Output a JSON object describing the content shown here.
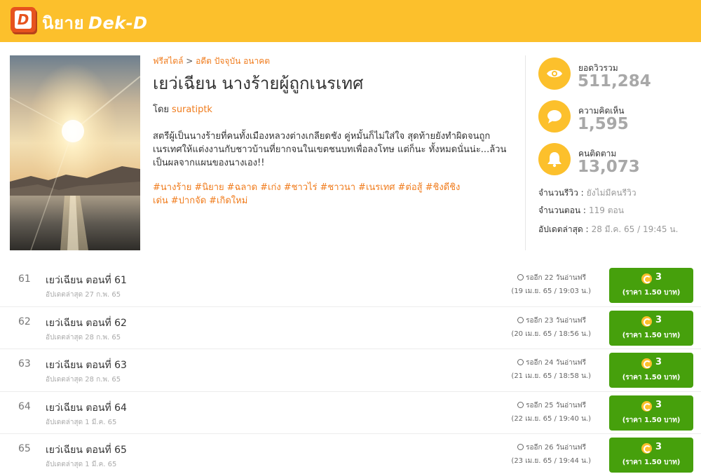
{
  "header": {
    "logo_letter": "D",
    "brand_thai": "นิยาย",
    "brand_dekd": "Dek-D"
  },
  "novel": {
    "breadcrumb": {
      "category": "ฟรีสไตล์",
      "separator": ">",
      "subcategory": "อดีต ปัจจุบัน อนาคต"
    },
    "title": "เยว่เฉียน นางร้ายผู้ถูกเนรเทศ",
    "by_label": "โดย",
    "author": "suratiptk",
    "synopsis": "สตรีผู้เป็นนางร้ายที่คนทั้งเมืองหลวงต่างเกลียดชัง คู่หมั้นก็ไม่ใส่ใจ สุดท้ายยังทำผิดจนถูกเนรเทศให้แต่งงานกับชาวบ้านที่ยากจนในเขตชนบทเพื่อลงโทษ แต่ก็นะ ทั้งหมดนั่นน่ะ...ล้วนเป็นผลจากแผนของนางเอง!!",
    "tags": [
      "#นางร้าย",
      "#นิยาย",
      "#ฉลาด",
      "#เก่ง",
      "#ชาวไร่",
      "#ชาวนา",
      "#เนรเทศ",
      "#ต่อสู้",
      "#ชิงดีชิงเด่น",
      "#ปากจัด",
      "#เกิดใหม่"
    ]
  },
  "stats": {
    "views": {
      "label": "ยอดวิวรวม",
      "value": "511,284",
      "icon": "eye-icon"
    },
    "comments": {
      "label": "ความคิดเห็น",
      "value": "1,595",
      "icon": "speech-bubble-icon"
    },
    "followers": {
      "label": "คนติดตาม",
      "value": "13,073",
      "icon": "bell-icon"
    }
  },
  "meta": {
    "reviews_label": "จำนวนรีวิว :",
    "reviews_value": "ยังไม่มีคนรีวิว",
    "episodes_label": "จำนวนตอน :",
    "episodes_value": "119 ตอน",
    "updated_label": "อัปเดตล่าสุด :",
    "updated_value": "28 มี.ค. 65 / 19:45 น."
  },
  "colors": {
    "brand_yellow": "#fcc02c",
    "link_orange": "#f07c1d",
    "buy_green": "#46a00c"
  },
  "episodes": [
    {
      "num": "61",
      "title": "เยว่เฉียน ตอนที่ 61",
      "updated": "อัปเดตล่าสุด 27 ก.พ. 65",
      "free_in": "รออีก 22 วันอ่านฟรี",
      "free_date": "(19 เม.ย. 65 / 19:03 น.)",
      "coins": "3",
      "price": "(ราคา 1.50 บาท)"
    },
    {
      "num": "62",
      "title": "เยว่เฉียน ตอนที่ 62",
      "updated": "อัปเดตล่าสุด 28 ก.พ. 65",
      "free_in": "รออีก 23 วันอ่านฟรี",
      "free_date": "(20 เม.ย. 65 / 18:56 น.)",
      "coins": "3",
      "price": "(ราคา 1.50 บาท)"
    },
    {
      "num": "63",
      "title": "เยว่เฉียน ตอนที่ 63",
      "updated": "อัปเดตล่าสุด 28 ก.พ. 65",
      "free_in": "รออีก 24 วันอ่านฟรี",
      "free_date": "(21 เม.ย. 65 / 18:58 น.)",
      "coins": "3",
      "price": "(ราคา 1.50 บาท)"
    },
    {
      "num": "64",
      "title": "เยว่เฉียน ตอนที่ 64",
      "updated": "อัปเดตล่าสุด 1 มี.ค. 65",
      "free_in": "รออีก 25 วันอ่านฟรี",
      "free_date": "(22 เม.ย. 65 / 19:40 น.)",
      "coins": "3",
      "price": "(ราคา 1.50 บาท)"
    },
    {
      "num": "65",
      "title": "เยว่เฉียน ตอนที่ 65",
      "updated": "อัปเดตล่าสุด 1 มี.ค. 65",
      "free_in": "รออีก 26 วันอ่านฟรี",
      "free_date": "(23 เม.ย. 65 / 19:44 น.)",
      "coins": "3",
      "price": "(ราคา 1.50 บาท)"
    }
  ]
}
